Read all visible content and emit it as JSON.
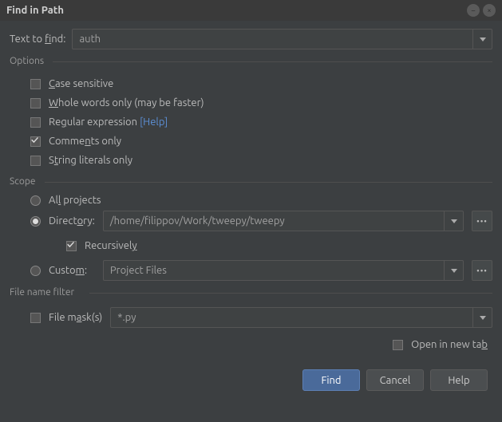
{
  "window": {
    "title": "Find in Path"
  },
  "search": {
    "label_pre": "Text to ",
    "label_u": "f",
    "label_post": "ind:",
    "value": "auth"
  },
  "options": {
    "legend": "Options",
    "case": {
      "u": "C",
      "post": "ase sensitive"
    },
    "whole": {
      "u": "W",
      "post": "hole words only (may be faster)"
    },
    "regex": {
      "pre": "Re",
      "u": "g",
      "post": "ular expression "
    },
    "regex_help": "[Help]",
    "comments": {
      "pre": "Comme",
      "u": "n",
      "post": "ts only"
    },
    "strings": {
      "pre": "S",
      "u": "t",
      "post": "ring literals only"
    }
  },
  "scope": {
    "legend": "Scope",
    "all": {
      "pre": "Al",
      "u": "l",
      "post": " projects"
    },
    "directory": {
      "pre": "Direct",
      "u": "o",
      "post": "ry:"
    },
    "directory_value": "/home/filippov/Work/tweepy/tweepy",
    "recursive": {
      "pre": "Recursivel",
      "u": "y",
      "post": ""
    },
    "custom": {
      "pre": "Custo",
      "u": "m",
      "post": ":"
    },
    "custom_value": "Project Files"
  },
  "filter": {
    "legend": "File name filter",
    "mask": {
      "pre": "File m",
      "u": "a",
      "post": "sk(s)"
    },
    "mask_value": "*.py"
  },
  "footer": {
    "open_tab": {
      "pre": "Open in new ta",
      "u": "b",
      "post": ""
    },
    "find": "Find",
    "cancel": "Cancel",
    "help": "Help"
  }
}
